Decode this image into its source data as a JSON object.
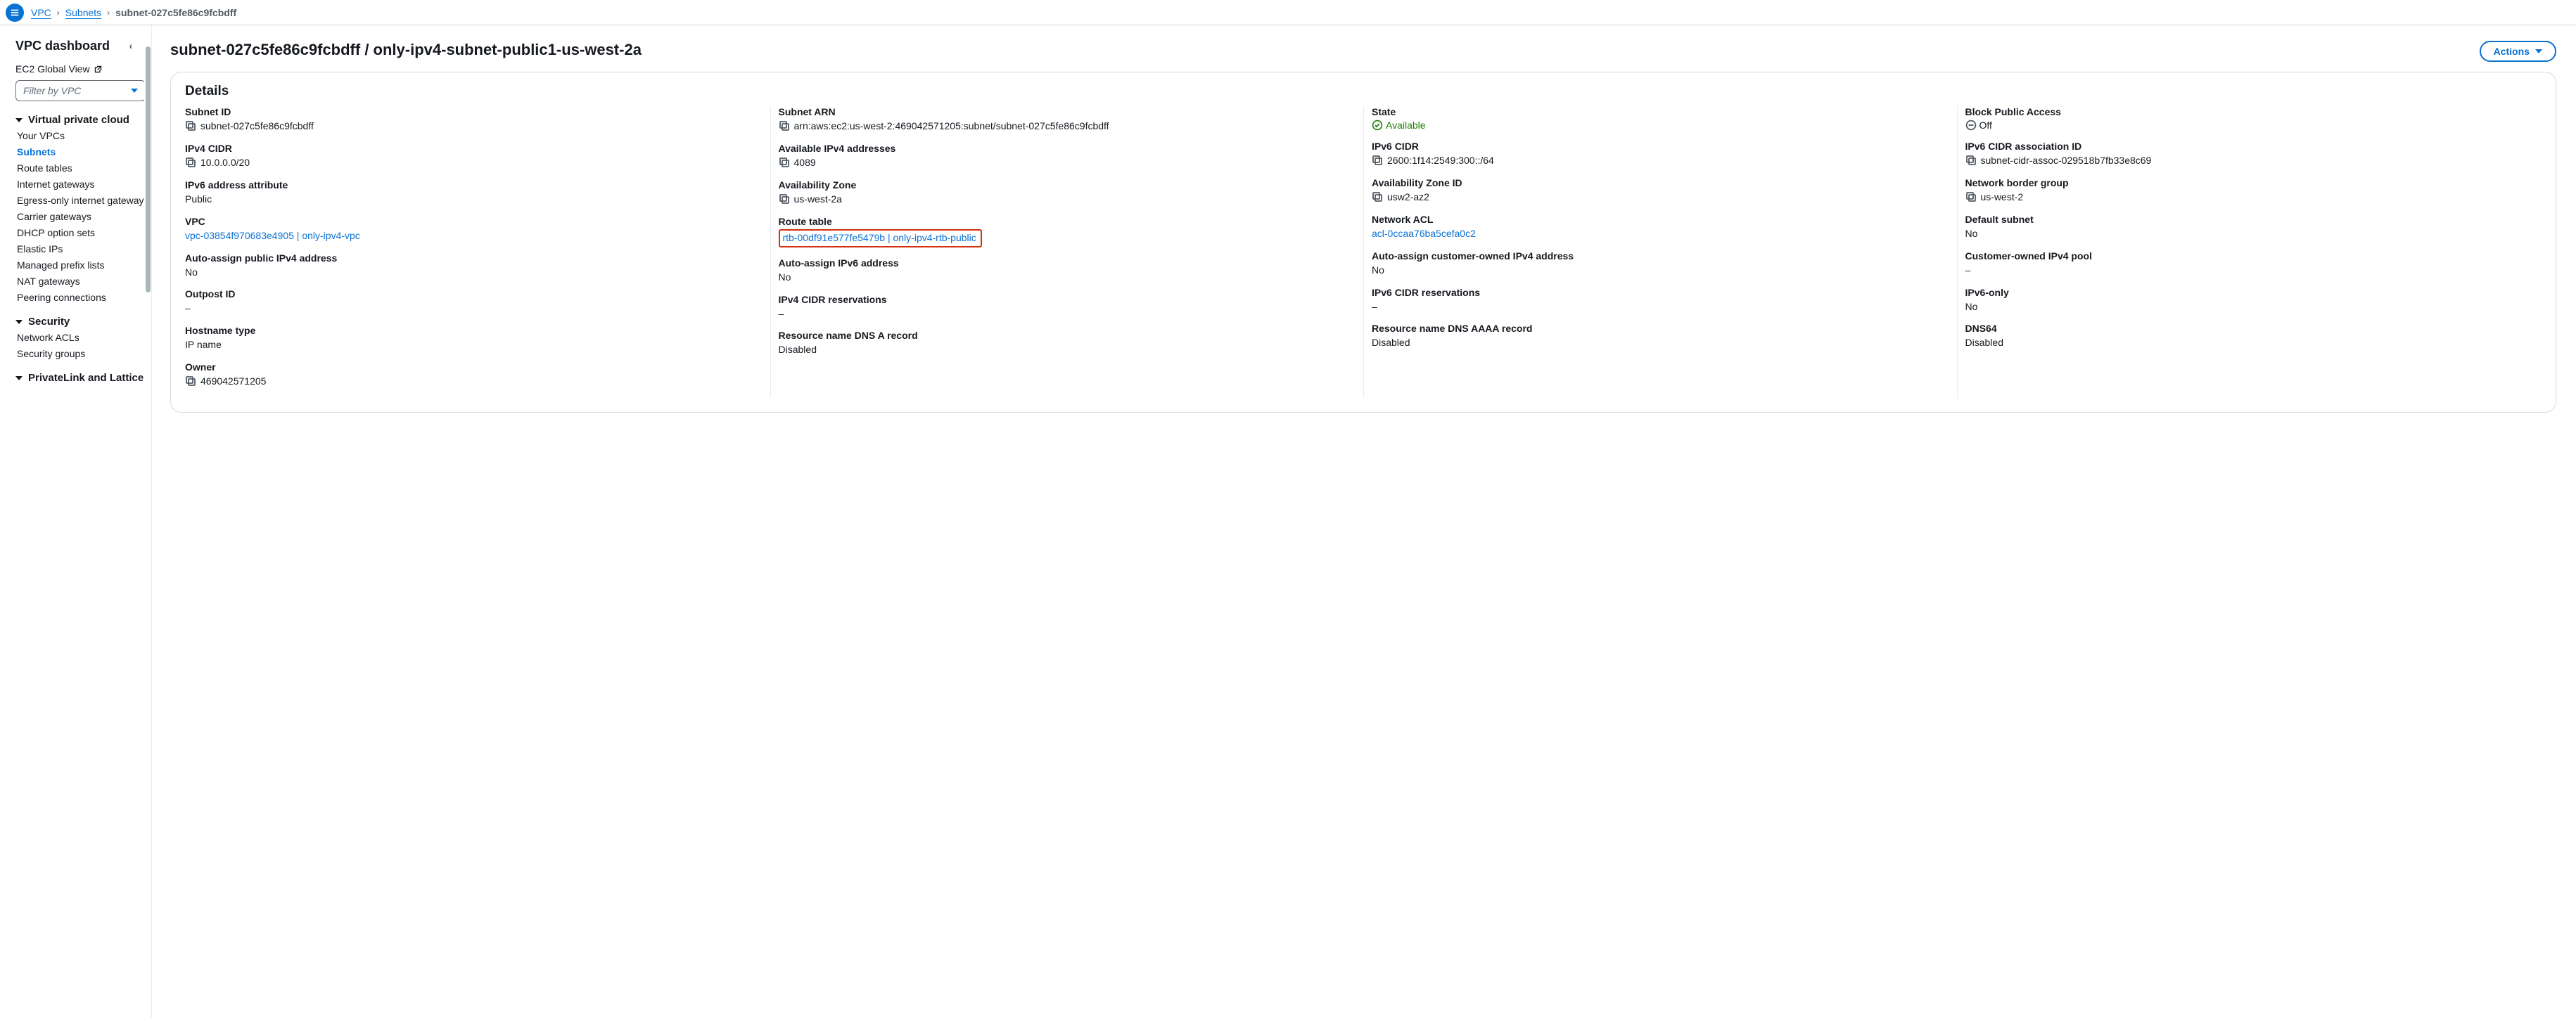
{
  "breadcrumbs": {
    "root": "VPC",
    "mid": "Subnets",
    "leaf": "subnet-027c5fe86c9fcbdff"
  },
  "sidebar": {
    "title": "VPC dashboard",
    "ec2_link": "EC2 Global View",
    "filter_placeholder": "Filter by VPC",
    "sections": [
      {
        "title": "Virtual private cloud",
        "items": [
          "Your VPCs",
          "Subnets",
          "Route tables",
          "Internet gateways",
          "Egress-only internet gateways",
          "Carrier gateways",
          "DHCP option sets",
          "Elastic IPs",
          "Managed prefix lists",
          "NAT gateways",
          "Peering connections"
        ],
        "active_index": 1
      },
      {
        "title": "Security",
        "items": [
          "Network ACLs",
          "Security groups"
        ]
      },
      {
        "title": "PrivateLink and Lattice",
        "items": []
      }
    ]
  },
  "header": {
    "title": "subnet-027c5fe86c9fcbdff / only-ipv4-subnet-public1-us-west-2a",
    "actions_label": "Actions"
  },
  "panel": {
    "title": "Details"
  },
  "details": {
    "col1": {
      "subnet_id_label": "Subnet ID",
      "subnet_id": "subnet-027c5fe86c9fcbdff",
      "ipv4_cidr_label": "IPv4 CIDR",
      "ipv4_cidr": "10.0.0.0/20",
      "ipv6_attr_label": "IPv6 address attribute",
      "ipv6_attr": "Public",
      "vpc_label": "VPC",
      "vpc": "vpc-03854f970683e4905 | only-ipv4-vpc",
      "auto_pub4_label": "Auto-assign public IPv4 address",
      "auto_pub4": "No",
      "outpost_label": "Outpost ID",
      "outpost": "–",
      "hostname_label": "Hostname type",
      "hostname": "IP name",
      "owner_label": "Owner",
      "owner": "469042571205"
    },
    "col2": {
      "arn_label": "Subnet ARN",
      "arn": "arn:aws:ec2:us-west-2:469042571205:subnet/subnet-027c5fe86c9fcbdff",
      "avail4_label": "Available IPv4 addresses",
      "avail4": "4089",
      "az_label": "Availability Zone",
      "az": "us-west-2a",
      "rtb_label": "Route table",
      "rtb": "rtb-00df91e577fe5479b | only-ipv4-rtb-public",
      "auto6_label": "Auto-assign IPv6 address",
      "auto6": "No",
      "ipv4res_label": "IPv4 CIDR reservations",
      "ipv4res": "–",
      "dnsa_label": "Resource name DNS A record",
      "dnsa": "Disabled"
    },
    "col3": {
      "state_label": "State",
      "state": "Available",
      "ipv6_cidr_label": "IPv6 CIDR",
      "ipv6_cidr": "2600:1f14:2549:300::/64",
      "azid_label": "Availability Zone ID",
      "azid": "usw2-az2",
      "nacl_label": "Network ACL",
      "nacl": "acl-0ccaa76ba5cefa0c2",
      "auto_co_label": "Auto-assign customer-owned IPv4 address",
      "auto_co": "No",
      "ipv6res_label": "IPv6 CIDR reservations",
      "ipv6res": "–",
      "aaaa_label": "Resource name DNS AAAA record",
      "aaaa": "Disabled"
    },
    "col4": {
      "bpa_label": "Block Public Access",
      "bpa": "Off",
      "ipv6assoc_label": "IPv6 CIDR association ID",
      "ipv6assoc": "subnet-cidr-assoc-029518b7fb33e8c69",
      "nbg_label": "Network border group",
      "nbg": "us-west-2",
      "defsub_label": "Default subnet",
      "defsub": "No",
      "coippool_label": "Customer-owned IPv4 pool",
      "coippool": "–",
      "ipv6only_label": "IPv6-only",
      "ipv6only": "No",
      "dns64_label": "DNS64",
      "dns64": "Disabled"
    }
  }
}
